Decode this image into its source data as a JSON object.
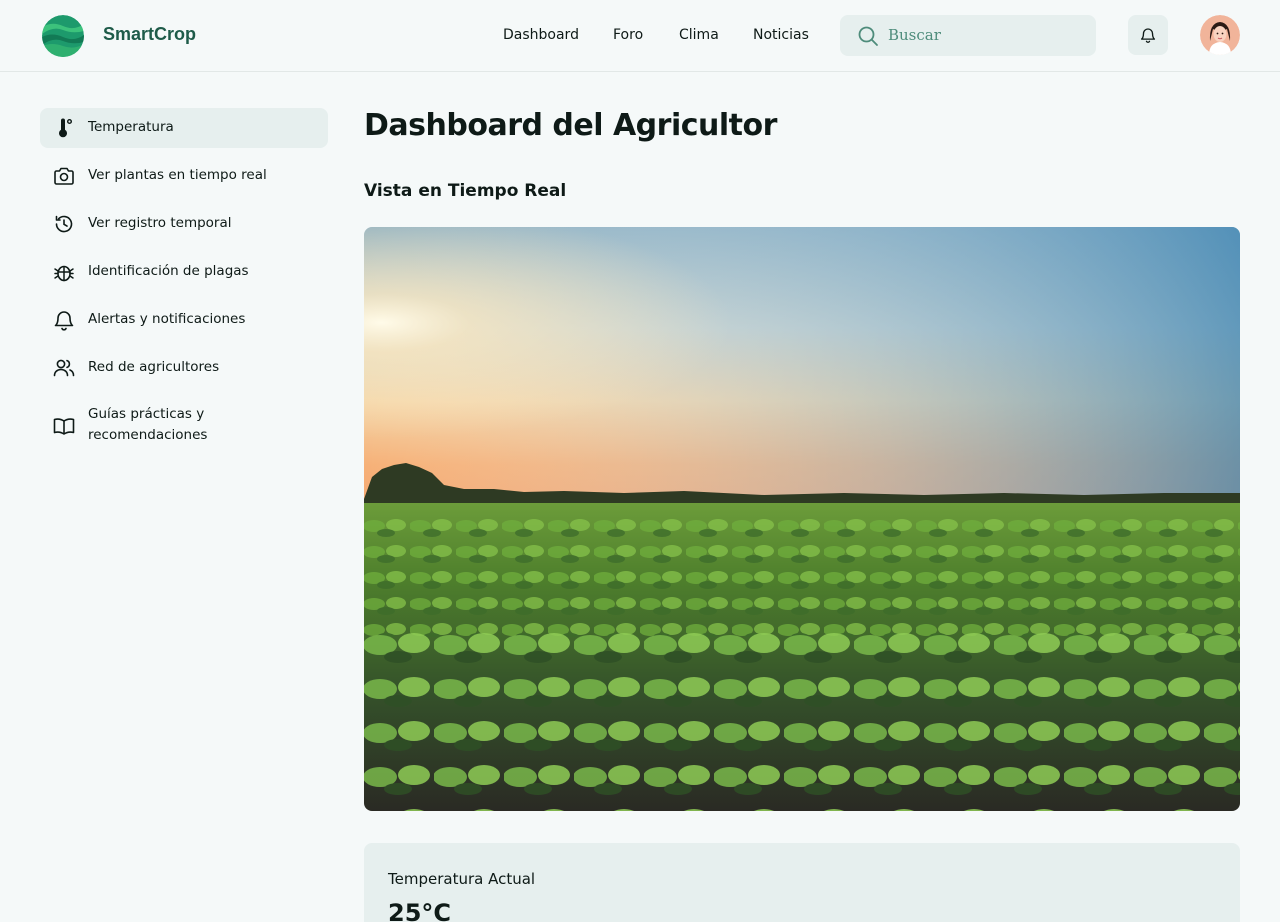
{
  "app": {
    "brand": "SmartCrop",
    "logo_icon": "earth-stripes-logo",
    "colors": {
      "brand": "#1e5b49",
      "accent_bg": "#e6efee",
      "page_bg": "#f5f9f9"
    }
  },
  "header": {
    "nav": [
      {
        "label": "Dashboard"
      },
      {
        "label": "Foro"
      },
      {
        "label": "Clima"
      },
      {
        "label": "Noticias"
      }
    ],
    "search": {
      "placeholder": "Buscar",
      "value": "",
      "icon": "search-icon"
    },
    "notifications_icon": "bell-icon",
    "avatar": "user-avatar"
  },
  "sidebar": {
    "items": [
      {
        "label": "Temperatura",
        "icon": "thermometer-icon",
        "active": true
      },
      {
        "label": "Ver plantas en tiempo real",
        "icon": "camera-icon"
      },
      {
        "label": "Ver registro temporal",
        "icon": "history-icon"
      },
      {
        "label": "Identificación de plagas",
        "icon": "bug-icon"
      },
      {
        "label": "Alertas y notificaciones",
        "icon": "bell-icon"
      },
      {
        "label": "Red de agricultores",
        "icon": "users-icon"
      },
      {
        "label": "Guías prácticas y recomendaciones",
        "icon": "book-icon"
      }
    ]
  },
  "main": {
    "title": "Dashboard del Agricultor",
    "live_view": {
      "title": "Vista en Tiempo Real",
      "image": "crop-field-sunset"
    },
    "temperature_card": {
      "label": "Temperatura Actual",
      "value": "25°C"
    }
  }
}
